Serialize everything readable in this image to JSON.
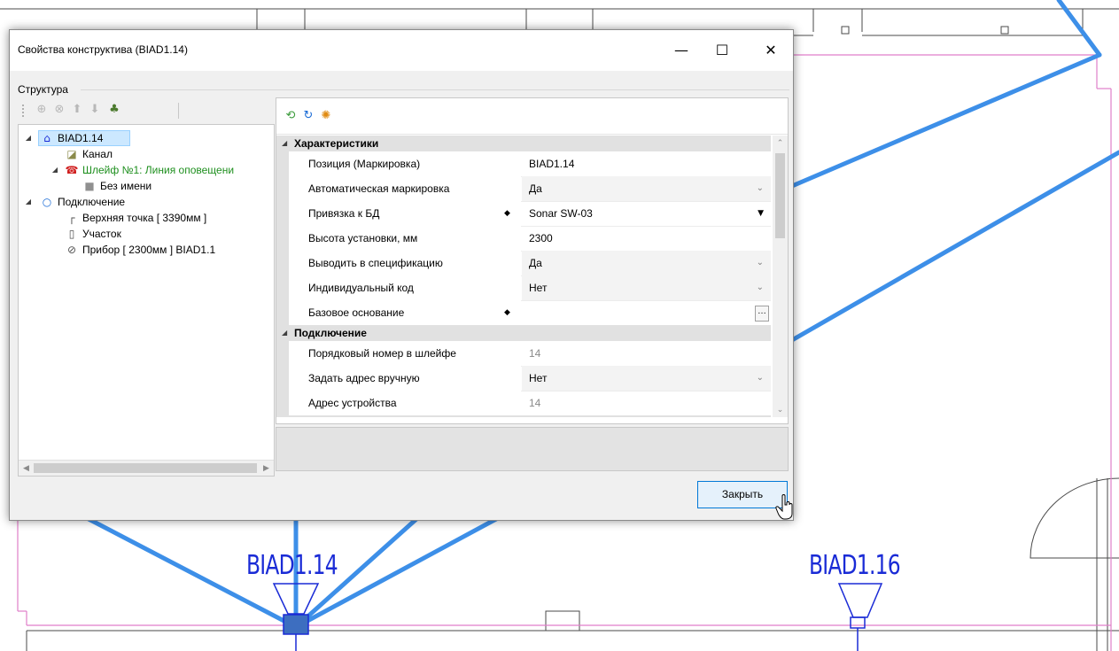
{
  "cad": {
    "labels": [
      "BIAD1.14",
      "BIAD1.16"
    ],
    "colors": {
      "wall": "#e07ec9",
      "outline": "#4a4a4a",
      "cable": "#3d8fe8",
      "device": "#1a2bd6"
    }
  },
  "dialog": {
    "title": "Свойства конструктива (BIAD1.14)",
    "window_controls": {
      "minimize": "—",
      "maximize": "☐",
      "close": "✕"
    },
    "group_label": "Структура",
    "close_button": "Закрыть"
  },
  "toolbar_left": {
    "icons": [
      "add-icon",
      "remove-icon",
      "move-up-icon",
      "move-down-icon",
      "connect-icon"
    ]
  },
  "toolbar_right": {
    "icons": [
      "refresh-db-icon",
      "update-icon",
      "settings-icon"
    ]
  },
  "tree": {
    "items": [
      {
        "label": "BIAD1.14",
        "icon": "device-icon",
        "selected": true
      },
      {
        "label": "Канал",
        "icon": "channel-icon"
      },
      {
        "label": "Шлейф №1: Линия оповещени",
        "icon": "loop-icon",
        "color": "#1e8f1e"
      },
      {
        "label": "Без имени",
        "icon": "square-icon"
      },
      {
        "label": "Подключение",
        "icon": "connection-icon"
      },
      {
        "label": "Верхняя точка [ 3390мм ]",
        "icon": "corner-icon"
      },
      {
        "label": "Участок",
        "icon": "segment-icon"
      },
      {
        "label": "Прибор [ 2300мм ] BIAD1.1",
        "icon": "device-node-icon"
      }
    ]
  },
  "property_grid": {
    "categories": [
      {
        "label": "Характеристики",
        "rows": [
          {
            "name": "Позиция (Маркировка)",
            "value": "BIAD1.14"
          },
          {
            "name": "Автоматическая маркировка",
            "value": "Да"
          },
          {
            "name": "Привязка к БД",
            "value": "Sonar SW-03"
          },
          {
            "name": "Высота установки, мм",
            "value": "2300"
          },
          {
            "name": "Выводить в спецификацию",
            "value": "Да"
          },
          {
            "name": "Индивидуальный код",
            "value": "Нет"
          },
          {
            "name": "Базовое основание",
            "value": ""
          }
        ]
      },
      {
        "label": "Подключение",
        "rows": [
          {
            "name": "Порядковый номер в шлейфе",
            "value": "14"
          },
          {
            "name": "Задать адрес вручную",
            "value": "Нет"
          },
          {
            "name": "Адрес устройства",
            "value": "14"
          }
        ]
      }
    ]
  }
}
